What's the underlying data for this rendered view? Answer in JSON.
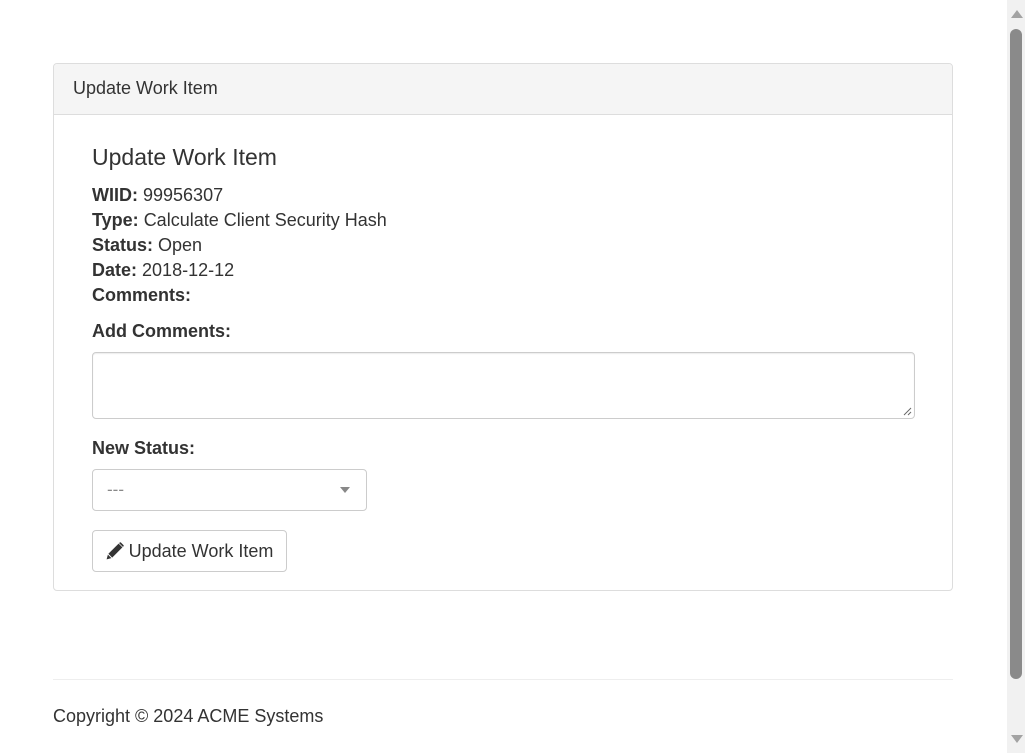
{
  "panel": {
    "heading": "Update Work Item"
  },
  "work_item": {
    "title": "Update Work Item",
    "fields": [
      {
        "label": "WIID:",
        "value": "99956307"
      },
      {
        "label": "Type:",
        "value": "Calculate Client Security Hash"
      },
      {
        "label": "Status:",
        "value": "Open"
      },
      {
        "label": "Date:",
        "value": "2018-12-12"
      },
      {
        "label": "Comments:",
        "value": ""
      }
    ]
  },
  "form": {
    "add_comments_label": "Add Comments:",
    "add_comments_value": "",
    "new_status_label": "New Status:",
    "new_status_selected": "---",
    "submit_label": "Update Work Item",
    "submit_icon": "pencil-icon"
  },
  "footer": {
    "copyright": "Copyright © 2024 ACME Systems"
  }
}
